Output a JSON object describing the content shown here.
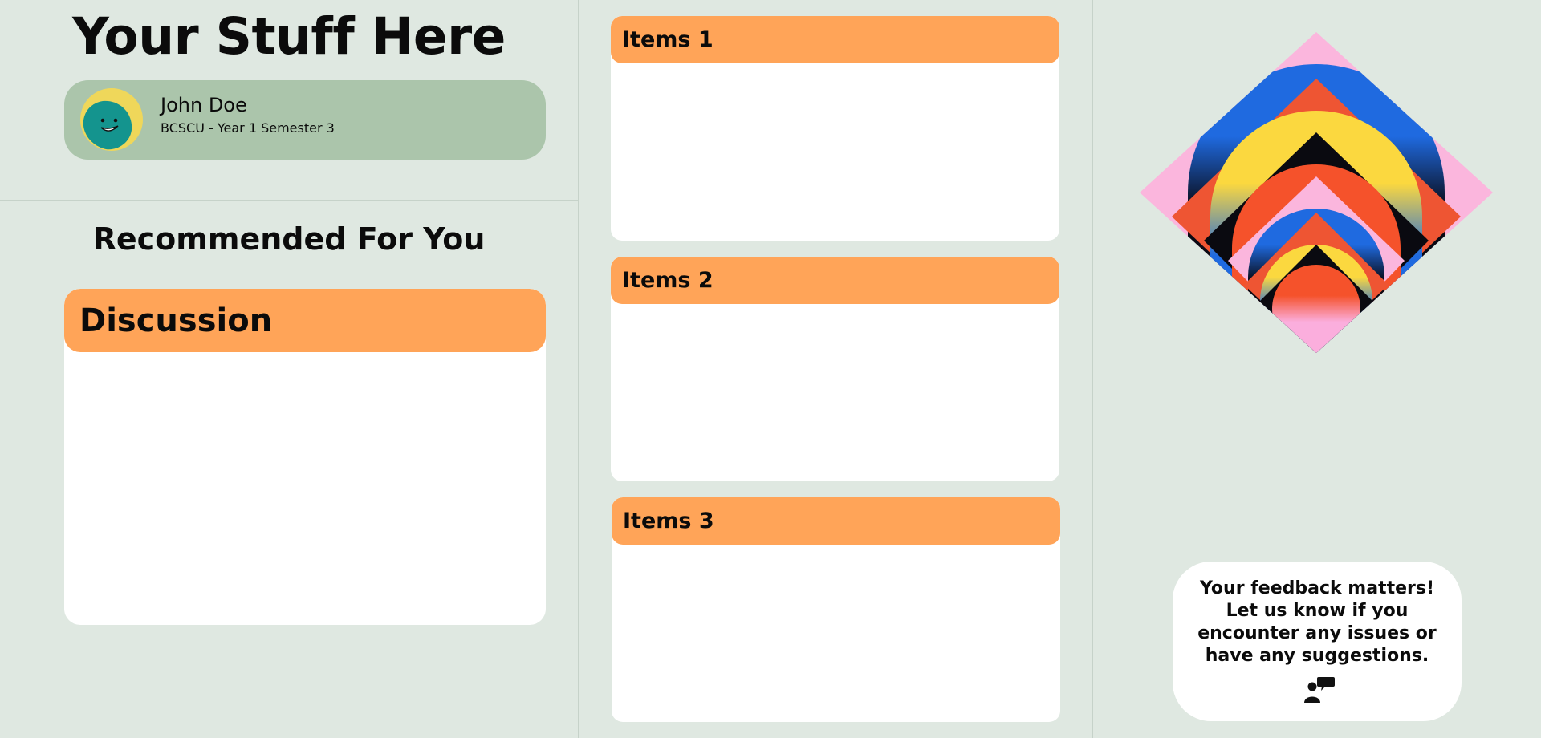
{
  "page": {
    "title": "Your Stuff Here"
  },
  "profile": {
    "name": "John Doe",
    "program": "BCSCU - Year 1 Semester 3",
    "avatar_icon": "smiley-face-icon"
  },
  "recommended": {
    "title": "Recommended For You",
    "discussion_label": "Discussion"
  },
  "items": [
    {
      "label": "Items 1"
    },
    {
      "label": "Items 2"
    },
    {
      "label": "Items 3"
    }
  ],
  "feedback": {
    "text": "Your feedback matters! Let us know if you encounter any issues or have any suggestions.",
    "icon": "chat-people-icon"
  },
  "colors": {
    "background": "#dfe8e1",
    "accent_orange": "#ffa458",
    "profile_card": "#abc5ab",
    "card_white": "#ffffff"
  }
}
